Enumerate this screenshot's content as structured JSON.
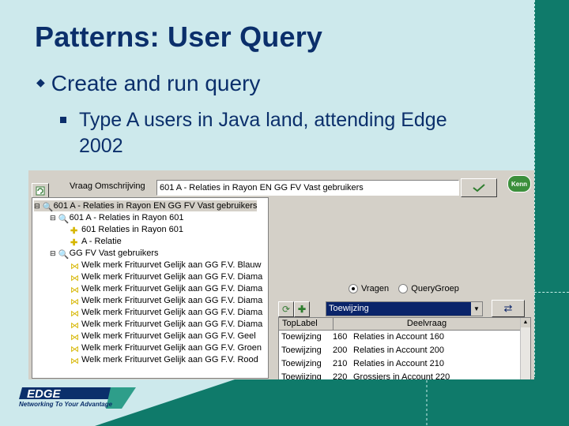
{
  "slide": {
    "title": "Patterns: User Query",
    "bullet1": "Create and run query",
    "bullet2": "Type A users in Java land, attending Edge 2002"
  },
  "app": {
    "vraag_label": "Vraag Omschrijving",
    "vraag_value": "601  A - Relaties in Rayon EN GG FV Vast gebruikers",
    "ok_label": "OK",
    "logo_label": "Kenn",
    "tree": [
      {
        "label": "601  A - Relaties in Rayon EN GG FV Vast gebruikers",
        "selected": true
      },
      {
        "label": "601  A - Relaties in Rayon 601"
      },
      {
        "label": "601  Relaties in Rayon 601"
      },
      {
        "label": "A - Relatie"
      },
      {
        "label": "GG FV Vast gebruikers"
      },
      {
        "label": "Welk merk Frituurvet Gelijk aan GG F.V. Blauw"
      },
      {
        "label": "Welk merk Frituurvet Gelijk aan GG F.V. Diama"
      },
      {
        "label": "Welk merk Frituurvet Gelijk aan GG F.V. Diama"
      },
      {
        "label": "Welk merk Frituurvet Gelijk aan GG F.V. Diama"
      },
      {
        "label": "Welk merk Frituurvet Gelijk aan GG F.V. Diama"
      },
      {
        "label": "Welk merk Frituurvet Gelijk aan GG F.V. Diama"
      },
      {
        "label": "Welk merk Frituurvet Gelijk aan GG F.V. Geel"
      },
      {
        "label": "Welk merk Frituurvet Gelijk aan GG F.V. Groen"
      },
      {
        "label": "Welk merk Frituurvet Gelijk aan GG F.V. Rood"
      }
    ],
    "radio_vragen": "Vragen",
    "radio_querygroep": "QueryGroep",
    "select_value": "Toewijzing",
    "grid_headers": [
      "TopLabel",
      "Deelvraag"
    ],
    "grid_rows": [
      {
        "toplabel": "Toewijzing",
        "num": "160",
        "deelvraag": "Relaties in Account 160"
      },
      {
        "toplabel": "Toewijzing",
        "num": "200",
        "deelvraag": "Relaties in Account 200"
      },
      {
        "toplabel": "Toewijzing",
        "num": "210",
        "deelvraag": "Relaties in Account 210"
      },
      {
        "toplabel": "Toewijzing",
        "num": "220",
        "deelvraag": "Grossiers in Account 220"
      }
    ]
  },
  "footer": {
    "logo_text": "EDGE",
    "tagline": "Networking To Your Advantage"
  },
  "colors": {
    "title": "#0b2f6b",
    "background": "#cde9ec",
    "band": "#0f7a6a",
    "selection": "#0a246a"
  }
}
